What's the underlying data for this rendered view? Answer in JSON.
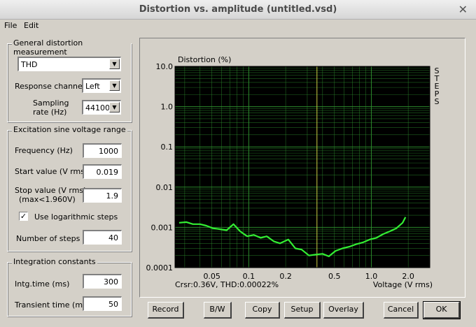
{
  "window": {
    "title": "Distortion vs. amplitude (untitled.vsd)",
    "close_glyph": "✕"
  },
  "menu": {
    "file": "File",
    "edit": "Edit"
  },
  "general": {
    "title": "General distortion measurement",
    "measurement": "THD",
    "response_label": "Response channel",
    "response_value": "Left",
    "sampling_label_1": "Sampling",
    "sampling_label_2": "rate (Hz)",
    "sampling_value": "44100"
  },
  "excitation": {
    "title": "Excitation sine voltage range",
    "frequency_label": "Frequency (Hz)",
    "frequency_value": "1000",
    "start_label": "Start value (V rms)",
    "start_value": "0.019",
    "stop_label_1": "Stop value (V rms)",
    "stop_label_2": "(max<1.960V)",
    "stop_value": "1.9",
    "log_label": "Use logarithmic steps",
    "log_checked": true,
    "steps_label": "Number of steps",
    "steps_value": "40"
  },
  "integration": {
    "title": "Integration constants",
    "intg_label": "Intg.time (ms)",
    "intg_value": "300",
    "transient_label": "Transient time (ms)",
    "transient_value": "50"
  },
  "buttons": {
    "record": "Record",
    "bw": "B/W",
    "copy": "Copy",
    "setup": "Setup",
    "overlay": "Overlay",
    "cancel": "Cancel",
    "ok": "OK"
  },
  "chart_data": {
    "type": "line",
    "title": "Distortion (%)",
    "xlabel": "Voltage (V rms)",
    "ylabel": "",
    "x_scale": "log",
    "y_scale": "log",
    "xlim": [
      0.025,
      3.0
    ],
    "ylim": [
      0.0001,
      10.0
    ],
    "x_ticks": [
      0.05,
      0.1,
      0.2,
      0.5,
      1.0,
      2.0
    ],
    "x_tick_labels": [
      "0.05",
      "0.1",
      "0.2",
      "0.5",
      "1.0",
      "2.0"
    ],
    "y_ticks": [
      10,
      1,
      0.1,
      0.01,
      0.001,
      0.0001
    ],
    "y_tick_labels": [
      "10.0",
      "1.0",
      "0.1",
      "0.01",
      "0.001",
      "0.0001"
    ],
    "right_label": "STEPS",
    "cursor_x": 0.36,
    "cursor_readout": "Crsr:0.36V, THD:0.00022%",
    "grid": true,
    "colors": {
      "background": "#000000",
      "grid": "#2f8f2f",
      "line": "#33ee33",
      "cursor": "#cccc44"
    },
    "series": [
      {
        "x": [
          0.019,
          0.021,
          0.024,
          0.027,
          0.031,
          0.035,
          0.04,
          0.045,
          0.051,
          0.058,
          0.066,
          0.075,
          0.085,
          0.097,
          0.11,
          0.125,
          0.14,
          0.16,
          0.18,
          0.21,
          0.24,
          0.27,
          0.31,
          0.35,
          0.4,
          0.45,
          0.51,
          0.58,
          0.66,
          0.75,
          0.85,
          0.97,
          1.1,
          1.25,
          1.42,
          1.6,
          1.8,
          1.9
        ],
        "values": [
          0.0022,
          0.0021,
          0.0016,
          0.0013,
          0.00135,
          0.0012,
          0.0012,
          0.0011,
          0.00095,
          0.0009,
          0.00085,
          0.0012,
          0.0008,
          0.0006,
          0.00065,
          0.00055,
          0.0006,
          0.00045,
          0.0004,
          0.0005,
          0.0003,
          0.00028,
          0.0002,
          0.00021,
          0.00022,
          0.00019,
          0.00026,
          0.0003,
          0.00033,
          0.00038,
          0.00042,
          0.0005,
          0.00055,
          0.00068,
          0.0008,
          0.00095,
          0.0013,
          0.0018
        ]
      }
    ]
  }
}
